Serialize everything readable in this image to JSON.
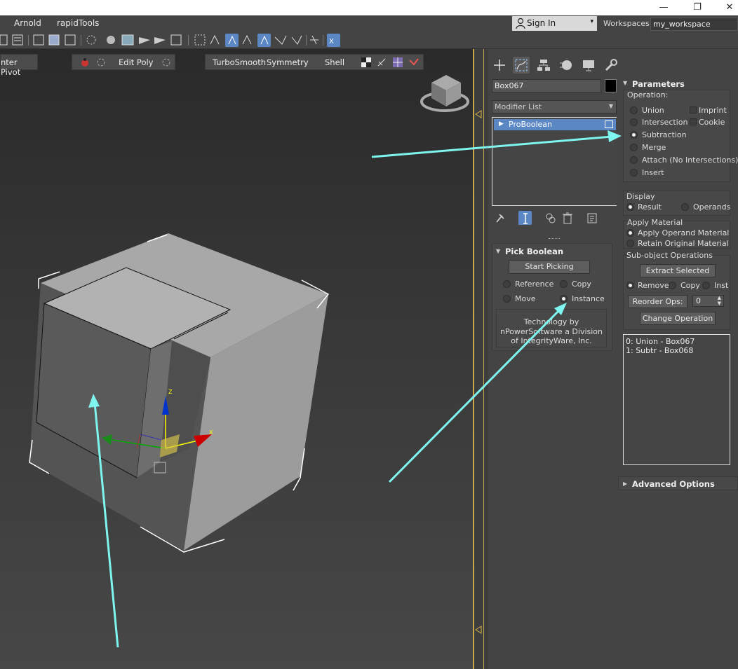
{
  "window": {
    "minimize_glyph": "—",
    "maximize_glyph": "❐",
    "close_glyph": "✕"
  },
  "menubar": {
    "items": [
      "Arnold",
      "rapidTools"
    ]
  },
  "signin": {
    "label": "Sign In",
    "arrow": "▾"
  },
  "workspaces": {
    "label": "Workspaces:",
    "value": "my_workspace"
  },
  "ribbon": {
    "center_pivot": "nter Pivot",
    "edit_poly": "Edit Poly",
    "turbosmooth": "TurboSmooth",
    "symmetry": "Symmetry",
    "shell": "Shell"
  },
  "command_panel": {
    "object_name": "Box067",
    "object_color": "#000000",
    "modifier_list": "Modifier List",
    "stack_item": "ProBoolean",
    "tabs": [
      "create-icon",
      "modify-icon",
      "hierarchy-icon",
      "motion-icon",
      "display-icon",
      "utilities-icon"
    ]
  },
  "pick_boolean": {
    "title": "Pick Boolean",
    "start_picking": "Start Picking",
    "reference": "Reference",
    "copy": "Copy",
    "move": "Move",
    "instance": "Instance",
    "selected": "Instance",
    "tech_line1": "Technology by",
    "tech_line2": "nPowerSoftware a Division",
    "tech_line3": "of IntegrityWare, Inc."
  },
  "parameters": {
    "title": "Parameters",
    "operation_label": "Operation:",
    "union": "Union",
    "intersection": "Intersection",
    "subtraction": "Subtraction",
    "merge": "Merge",
    "attach": "Attach (No Intersections)",
    "insert": "Insert",
    "imprint": "Imprint",
    "cookie": "Cookie",
    "selected_operation": "Subtraction",
    "display_label": "Display",
    "result": "Result",
    "operands": "Operands",
    "apply_material_label": "Apply Material",
    "apply_operand_material": "Apply Operand Material",
    "retain_original_material": "Retain Original Material",
    "subobject_label": "Sub-object Operations",
    "extract_selected": "Extract Selected",
    "remove": "Remove",
    "copy": "Copy",
    "inst": "Inst",
    "reorder_ops": "Reorder Ops:",
    "reorder_value": "0",
    "change_operation": "Change Operation",
    "operands_list": [
      "0: Union - Box067",
      "1: Subtr - Box068"
    ]
  },
  "advanced": {
    "title": "Advanced Options"
  },
  "gizmo": {
    "x": "X",
    "z": "Z"
  },
  "colors": {
    "annotation": "#7ff5f0",
    "selection": "#5b87c5",
    "viewport_border": "#c9a84a"
  }
}
